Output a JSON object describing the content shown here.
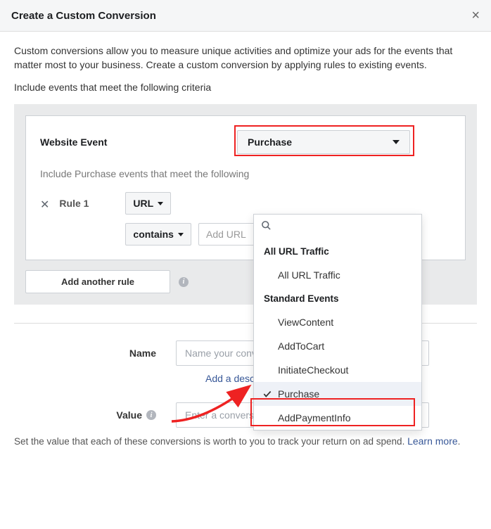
{
  "header": {
    "title": "Create a Custom Conversion"
  },
  "intro": "Custom conversions allow you to measure unique activities and optimize your ads for the events that matter most to your business. Create a custom conversion by applying rules to existing events.",
  "criteria": "Include events that meet the following criteria",
  "event": {
    "label": "Website Event",
    "selected": "Purchase",
    "include_text": "Include Purchase events that meet the following",
    "rule_label": "Rule 1",
    "field": "URL",
    "operator": "contains",
    "value_placeholder": "Add URL",
    "add_rule": "Add another rule"
  },
  "dropdown": {
    "sections": [
      {
        "title": "All URL Traffic",
        "items": [
          "All URL Traffic"
        ]
      },
      {
        "title": "Standard Events",
        "items": [
          "ViewContent",
          "AddToCart",
          "InitiateCheckout",
          "Purchase",
          "AddPaymentInfo"
        ]
      }
    ],
    "selected": "Purchase"
  },
  "form": {
    "name_label": "Name",
    "name_placeholder": "Name your conversion",
    "add_description": "Add a description",
    "value_label": "Value",
    "value_placeholder": "Enter a conversion value (optional)"
  },
  "bottom": {
    "text": "Set the value that each of these conversions is worth to you to track your return on ad spend. ",
    "learn_more": "Learn more"
  }
}
